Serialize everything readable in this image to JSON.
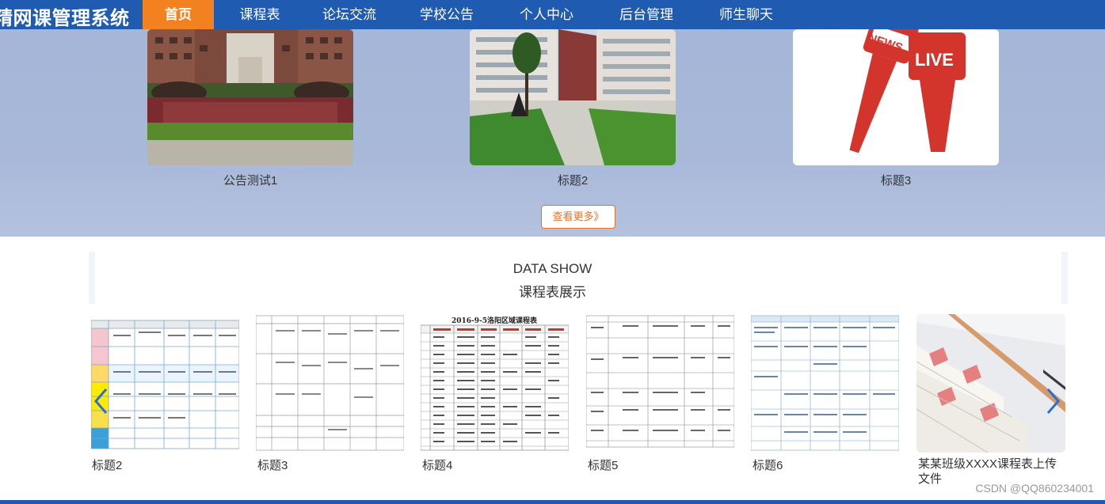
{
  "header": {
    "brand": "精网课管理系统",
    "nav": [
      {
        "label": "首页",
        "active": true
      },
      {
        "label": "课程表"
      },
      {
        "label": "论坛交流"
      },
      {
        "label": "学校公告"
      },
      {
        "label": "个人中心"
      },
      {
        "label": "后台管理"
      },
      {
        "label": "师生聊天"
      }
    ]
  },
  "notices": {
    "items": [
      {
        "caption": "公告测试1"
      },
      {
        "caption": "标题2"
      },
      {
        "caption": "标题3"
      }
    ],
    "more_label": "查看更多》",
    "live_text": "LIVE",
    "news_text": "NEWS"
  },
  "data_show": {
    "title_en": "DATA SHOW",
    "title_zh": "课程表展示",
    "items": [
      {
        "caption": "标题2"
      },
      {
        "caption": "标题3"
      },
      {
        "caption": "标题4",
        "table_title": "2016-9-5洛阳区域课程表"
      },
      {
        "caption": "标题5"
      },
      {
        "caption": "标题6"
      },
      {
        "caption": "某某班级XXXX课程表上传文件"
      }
    ],
    "prev_icon": "chevron-left-icon",
    "next_icon": "chevron-right-icon"
  },
  "watermark": "CSDN @QQ860234001",
  "colors": {
    "nav_bg": "#1f5bb0",
    "nav_active": "#f2821f",
    "band_bg": "#a8b8d9",
    "accent": "#e3722a"
  }
}
